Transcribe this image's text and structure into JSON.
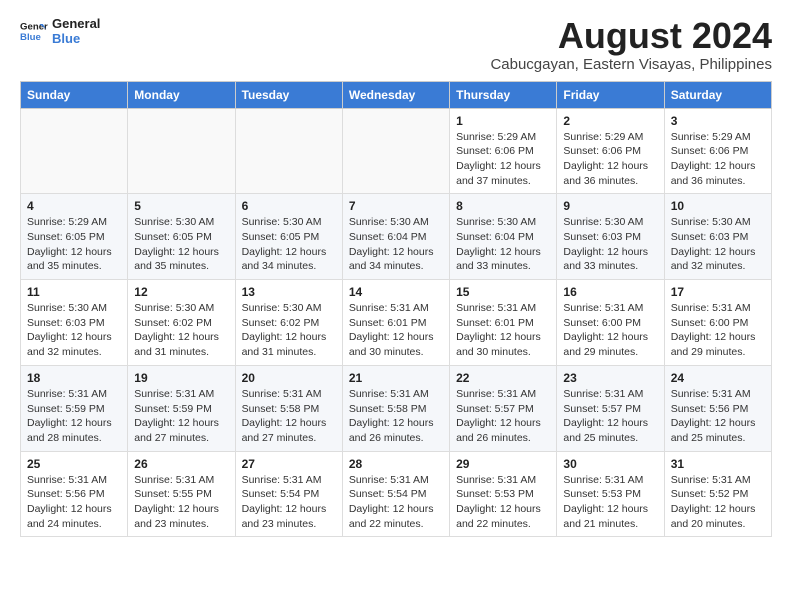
{
  "logo": {
    "line1": "General",
    "line2": "Blue"
  },
  "title": "August 2024",
  "subtitle": "Cabucgayan, Eastern Visayas, Philippines",
  "weekdays": [
    "Sunday",
    "Monday",
    "Tuesday",
    "Wednesday",
    "Thursday",
    "Friday",
    "Saturday"
  ],
  "weeks": [
    [
      {
        "day": "",
        "info": ""
      },
      {
        "day": "",
        "info": ""
      },
      {
        "day": "",
        "info": ""
      },
      {
        "day": "",
        "info": ""
      },
      {
        "day": "1",
        "info": "Sunrise: 5:29 AM\nSunset: 6:06 PM\nDaylight: 12 hours\nand 37 minutes."
      },
      {
        "day": "2",
        "info": "Sunrise: 5:29 AM\nSunset: 6:06 PM\nDaylight: 12 hours\nand 36 minutes."
      },
      {
        "day": "3",
        "info": "Sunrise: 5:29 AM\nSunset: 6:06 PM\nDaylight: 12 hours\nand 36 minutes."
      }
    ],
    [
      {
        "day": "4",
        "info": "Sunrise: 5:29 AM\nSunset: 6:05 PM\nDaylight: 12 hours\nand 35 minutes."
      },
      {
        "day": "5",
        "info": "Sunrise: 5:30 AM\nSunset: 6:05 PM\nDaylight: 12 hours\nand 35 minutes."
      },
      {
        "day": "6",
        "info": "Sunrise: 5:30 AM\nSunset: 6:05 PM\nDaylight: 12 hours\nand 34 minutes."
      },
      {
        "day": "7",
        "info": "Sunrise: 5:30 AM\nSunset: 6:04 PM\nDaylight: 12 hours\nand 34 minutes."
      },
      {
        "day": "8",
        "info": "Sunrise: 5:30 AM\nSunset: 6:04 PM\nDaylight: 12 hours\nand 33 minutes."
      },
      {
        "day": "9",
        "info": "Sunrise: 5:30 AM\nSunset: 6:03 PM\nDaylight: 12 hours\nand 33 minutes."
      },
      {
        "day": "10",
        "info": "Sunrise: 5:30 AM\nSunset: 6:03 PM\nDaylight: 12 hours\nand 32 minutes."
      }
    ],
    [
      {
        "day": "11",
        "info": "Sunrise: 5:30 AM\nSunset: 6:03 PM\nDaylight: 12 hours\nand 32 minutes."
      },
      {
        "day": "12",
        "info": "Sunrise: 5:30 AM\nSunset: 6:02 PM\nDaylight: 12 hours\nand 31 minutes."
      },
      {
        "day": "13",
        "info": "Sunrise: 5:30 AM\nSunset: 6:02 PM\nDaylight: 12 hours\nand 31 minutes."
      },
      {
        "day": "14",
        "info": "Sunrise: 5:31 AM\nSunset: 6:01 PM\nDaylight: 12 hours\nand 30 minutes."
      },
      {
        "day": "15",
        "info": "Sunrise: 5:31 AM\nSunset: 6:01 PM\nDaylight: 12 hours\nand 30 minutes."
      },
      {
        "day": "16",
        "info": "Sunrise: 5:31 AM\nSunset: 6:00 PM\nDaylight: 12 hours\nand 29 minutes."
      },
      {
        "day": "17",
        "info": "Sunrise: 5:31 AM\nSunset: 6:00 PM\nDaylight: 12 hours\nand 29 minutes."
      }
    ],
    [
      {
        "day": "18",
        "info": "Sunrise: 5:31 AM\nSunset: 5:59 PM\nDaylight: 12 hours\nand 28 minutes."
      },
      {
        "day": "19",
        "info": "Sunrise: 5:31 AM\nSunset: 5:59 PM\nDaylight: 12 hours\nand 27 minutes."
      },
      {
        "day": "20",
        "info": "Sunrise: 5:31 AM\nSunset: 5:58 PM\nDaylight: 12 hours\nand 27 minutes."
      },
      {
        "day": "21",
        "info": "Sunrise: 5:31 AM\nSunset: 5:58 PM\nDaylight: 12 hours\nand 26 minutes."
      },
      {
        "day": "22",
        "info": "Sunrise: 5:31 AM\nSunset: 5:57 PM\nDaylight: 12 hours\nand 26 minutes."
      },
      {
        "day": "23",
        "info": "Sunrise: 5:31 AM\nSunset: 5:57 PM\nDaylight: 12 hours\nand 25 minutes."
      },
      {
        "day": "24",
        "info": "Sunrise: 5:31 AM\nSunset: 5:56 PM\nDaylight: 12 hours\nand 25 minutes."
      }
    ],
    [
      {
        "day": "25",
        "info": "Sunrise: 5:31 AM\nSunset: 5:56 PM\nDaylight: 12 hours\nand 24 minutes."
      },
      {
        "day": "26",
        "info": "Sunrise: 5:31 AM\nSunset: 5:55 PM\nDaylight: 12 hours\nand 23 minutes."
      },
      {
        "day": "27",
        "info": "Sunrise: 5:31 AM\nSunset: 5:54 PM\nDaylight: 12 hours\nand 23 minutes."
      },
      {
        "day": "28",
        "info": "Sunrise: 5:31 AM\nSunset: 5:54 PM\nDaylight: 12 hours\nand 22 minutes."
      },
      {
        "day": "29",
        "info": "Sunrise: 5:31 AM\nSunset: 5:53 PM\nDaylight: 12 hours\nand 22 minutes."
      },
      {
        "day": "30",
        "info": "Sunrise: 5:31 AM\nSunset: 5:53 PM\nDaylight: 12 hours\nand 21 minutes."
      },
      {
        "day": "31",
        "info": "Sunrise: 5:31 AM\nSunset: 5:52 PM\nDaylight: 12 hours\nand 20 minutes."
      }
    ]
  ]
}
